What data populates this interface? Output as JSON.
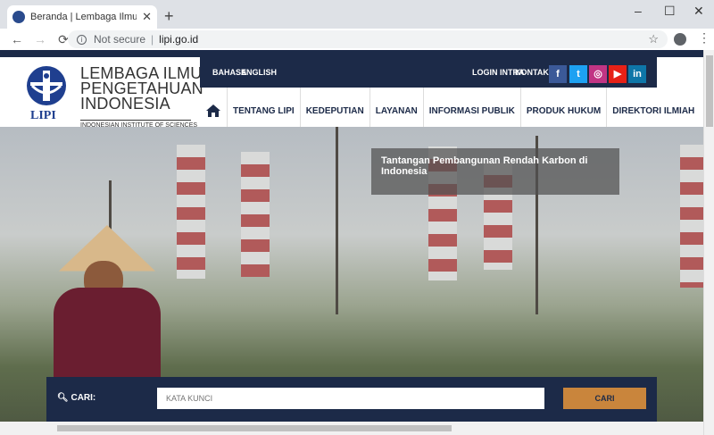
{
  "browser": {
    "tab_title": "Beranda | Lembaga Ilmu Pengetahuan",
    "new_tab": "+",
    "close_tab": "✕",
    "not_secure": "Not secure",
    "url": "lipi.go.id",
    "win_min": "–",
    "win_max": "☐",
    "win_close": "✕"
  },
  "header": {
    "logo_line1": "LEMBAGA ILMU",
    "logo_line2": "PENGETAHUAN",
    "logo_line3": "INDONESIA",
    "logo_sub": "INDONESIAN INSTITUTE OF SCIENCES",
    "logo_mark_text": "LIPI",
    "bahasa": "BAHASA",
    "english": "ENGLISH",
    "login": "LOGIN INTRA",
    "kontak": "KONTAK"
  },
  "social": [
    {
      "icon": "facebook-icon",
      "glyph": "f",
      "color": "#3b5998"
    },
    {
      "icon": "twitter-icon",
      "glyph": "t",
      "color": "#1da1f2"
    },
    {
      "icon": "instagram-icon",
      "glyph": "◎",
      "color": "#c13584"
    },
    {
      "icon": "youtube-icon",
      "glyph": "▶",
      "color": "#e62117"
    },
    {
      "icon": "linkedin-icon",
      "glyph": "in",
      "color": "#0e76a8"
    }
  ],
  "nav": {
    "home_icon": "home-icon",
    "items": [
      "TENTANG LIPI",
      "KEDEPUTIAN",
      "LAYANAN",
      "INFORMASI PUBLIK",
      "PRODUK HUKUM",
      "DIREKTORI ILMIAH"
    ]
  },
  "hero": {
    "caption": "Tantangan Pembangunan Rendah Karbon di Indonesia"
  },
  "search": {
    "label": "CARI:",
    "placeholder": "KATA KUNCI",
    "button": "CARI"
  },
  "colors": {
    "brand_navy": "#1c2a48",
    "logo_blue": "#1f3f8f",
    "button_orange": "#c9853c"
  }
}
